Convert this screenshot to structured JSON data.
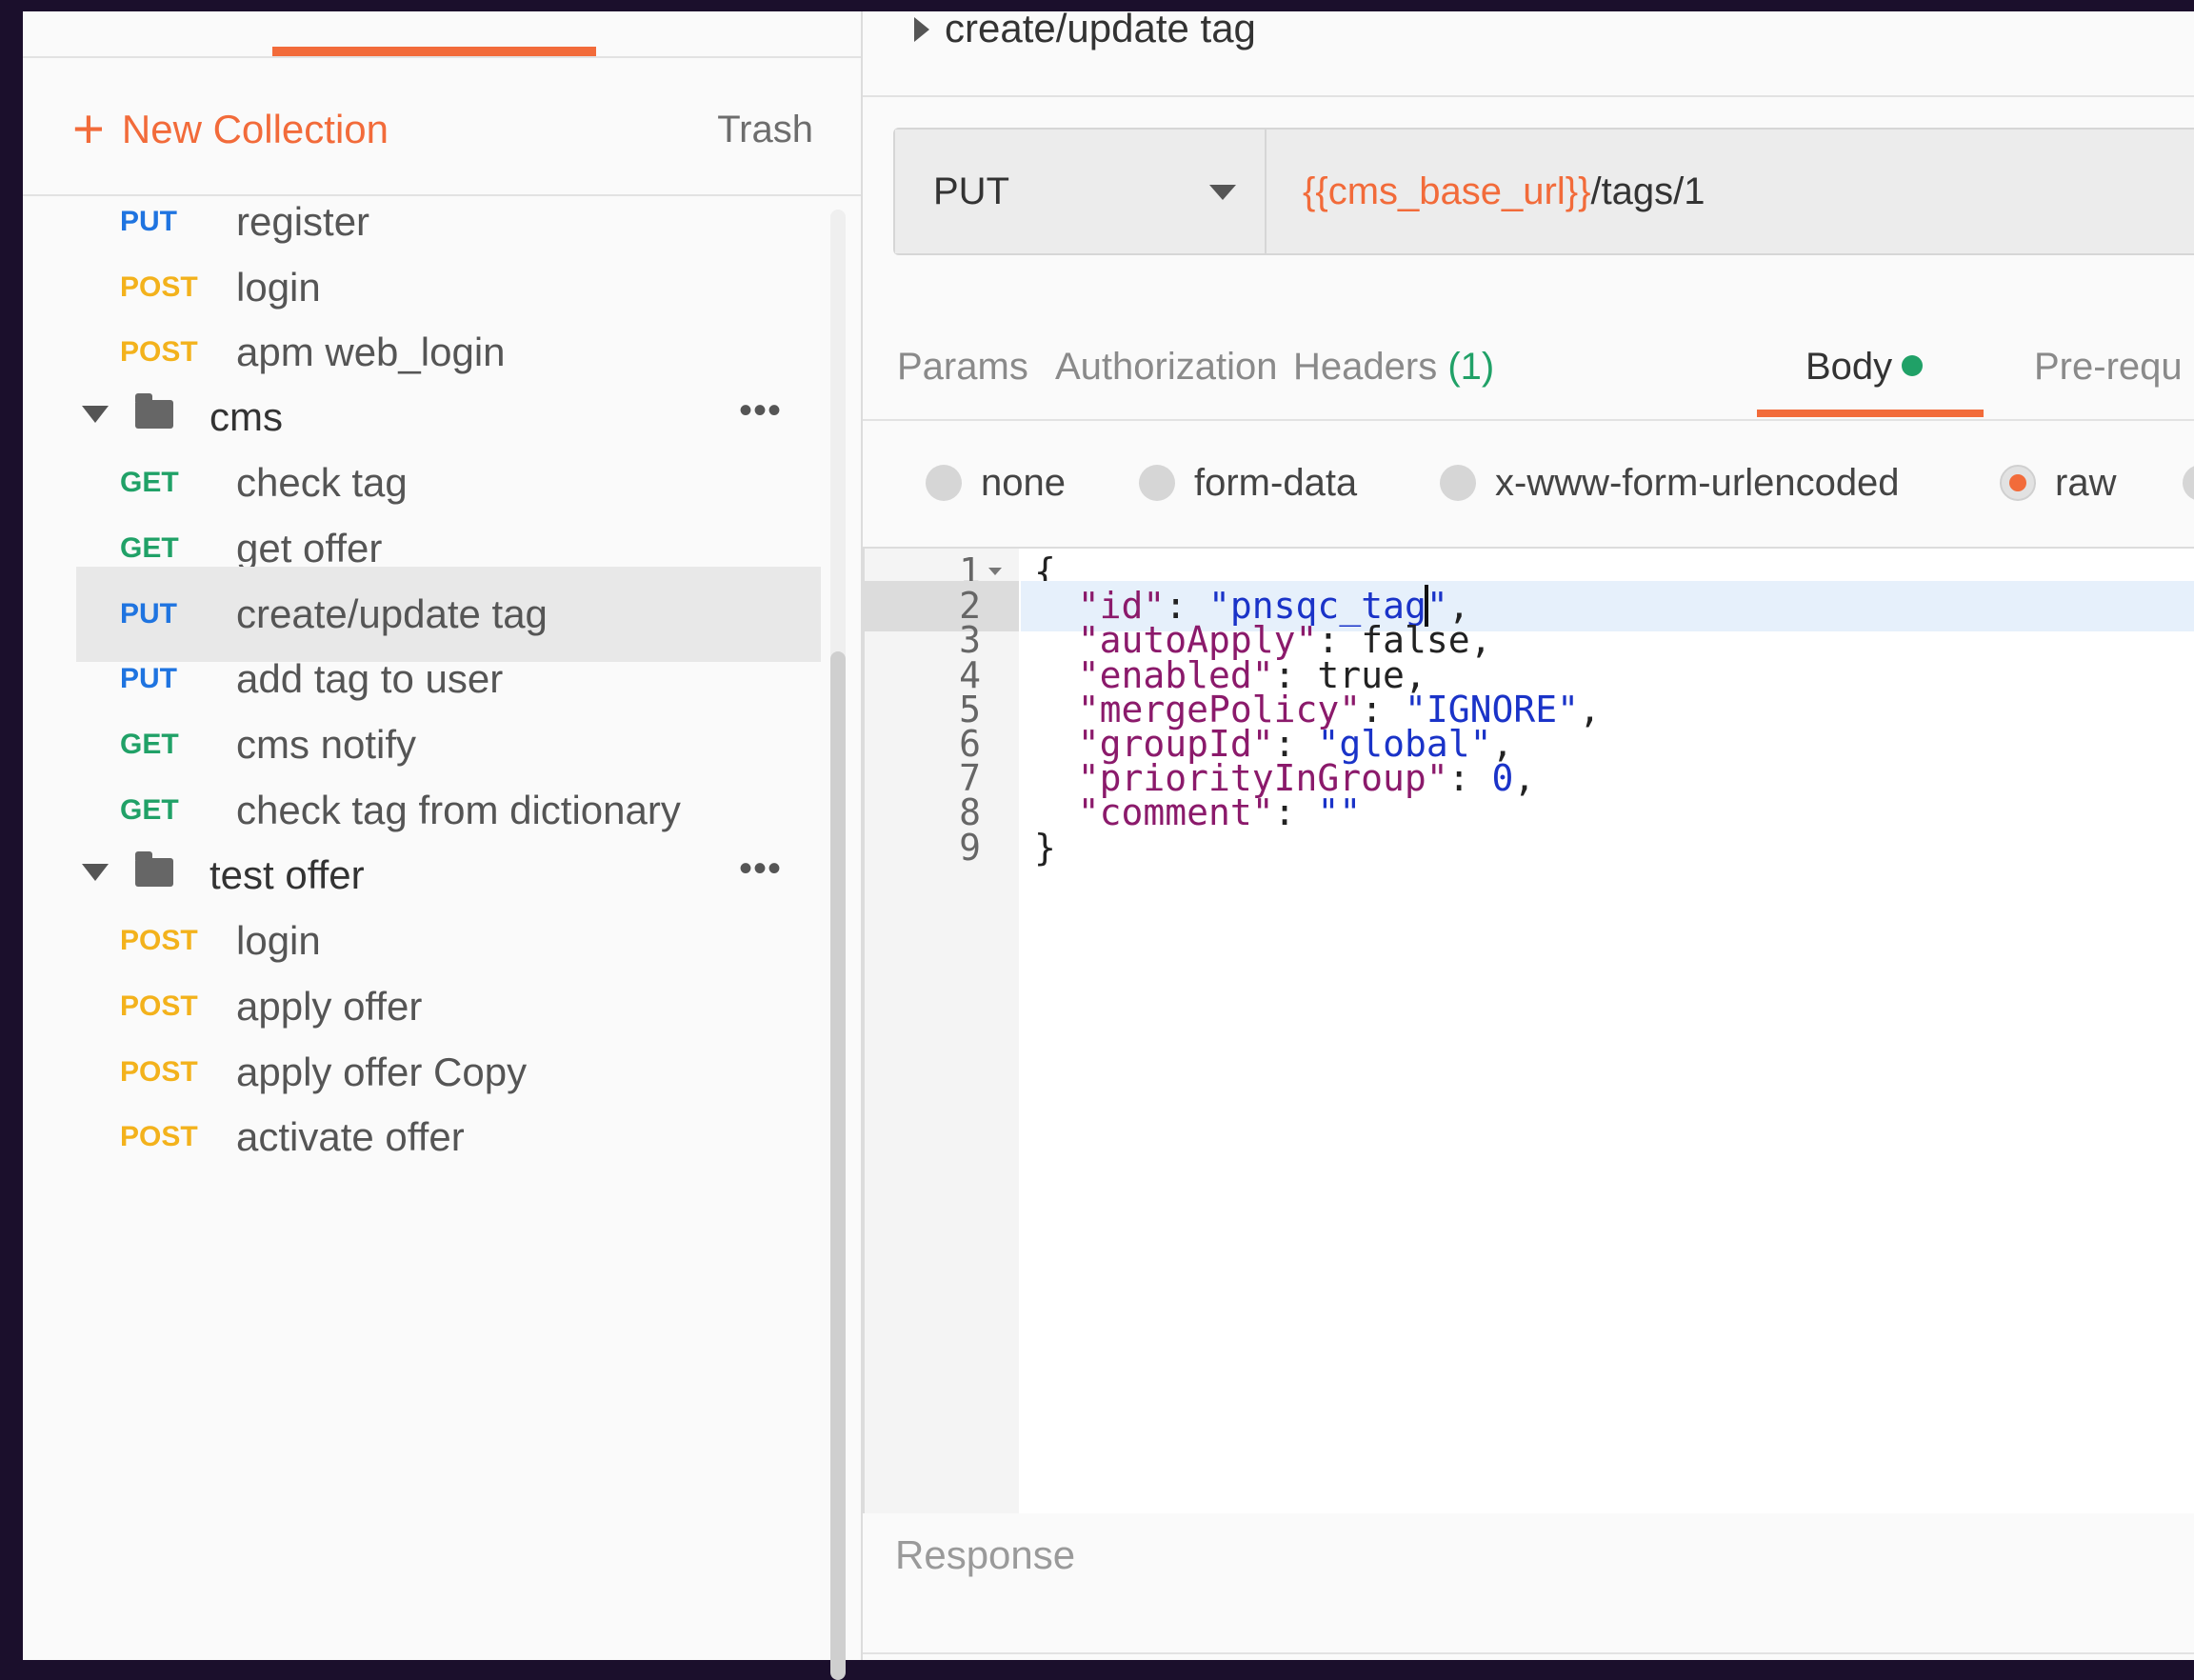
{
  "sidebar": {
    "new_collection_label": "New Collection",
    "trash_label": "Trash",
    "tree": [
      {
        "kind": "request",
        "method": "PUT",
        "name": "register"
      },
      {
        "kind": "request",
        "method": "POST",
        "name": "login"
      },
      {
        "kind": "request",
        "method": "POST",
        "name": "apm web_login"
      },
      {
        "kind": "folder",
        "name": "cms",
        "more": "•••"
      },
      {
        "kind": "request",
        "method": "GET",
        "name": "check tag"
      },
      {
        "kind": "request",
        "method": "GET",
        "name": "get offer"
      },
      {
        "kind": "request",
        "method": "PUT",
        "name": "create/update tag",
        "selected": true
      },
      {
        "kind": "request",
        "method": "PUT",
        "name": "add tag to user"
      },
      {
        "kind": "request",
        "method": "GET",
        "name": "cms notify"
      },
      {
        "kind": "request",
        "method": "GET",
        "name": "check tag from dictionary"
      },
      {
        "kind": "folder",
        "name": "test offer",
        "more": "•••"
      },
      {
        "kind": "request",
        "method": "POST",
        "name": "login"
      },
      {
        "kind": "request",
        "method": "POST",
        "name": "apply offer"
      },
      {
        "kind": "request",
        "method": "POST",
        "name": "apply offer Copy"
      },
      {
        "kind": "request",
        "method": "POST",
        "name": "activate offer"
      }
    ]
  },
  "request": {
    "title": "create/update tag",
    "method": "PUT",
    "url_variable": "{{cms_base_url}}",
    "url_path": "/tags/1"
  },
  "tabs": {
    "params": "Params",
    "authorization": "Authorization",
    "headers": "Headers",
    "headers_count": "(1)",
    "body": "Body",
    "pre_request": "Pre-requ"
  },
  "body_types": {
    "none": "none",
    "form_data": "form-data",
    "urlencoded": "x-www-form-urlencoded",
    "raw": "raw",
    "selected": "raw"
  },
  "editor": {
    "line_numbers": [
      "1",
      "2",
      "3",
      "4",
      "5",
      "6",
      "7",
      "8",
      "9"
    ],
    "active_line": "2"
  },
  "response": {
    "label": "Response"
  },
  "colors": {
    "accent": "#f26b3a",
    "get": "#20a167",
    "post": "#f3b21c",
    "put": "#1f74e0"
  }
}
